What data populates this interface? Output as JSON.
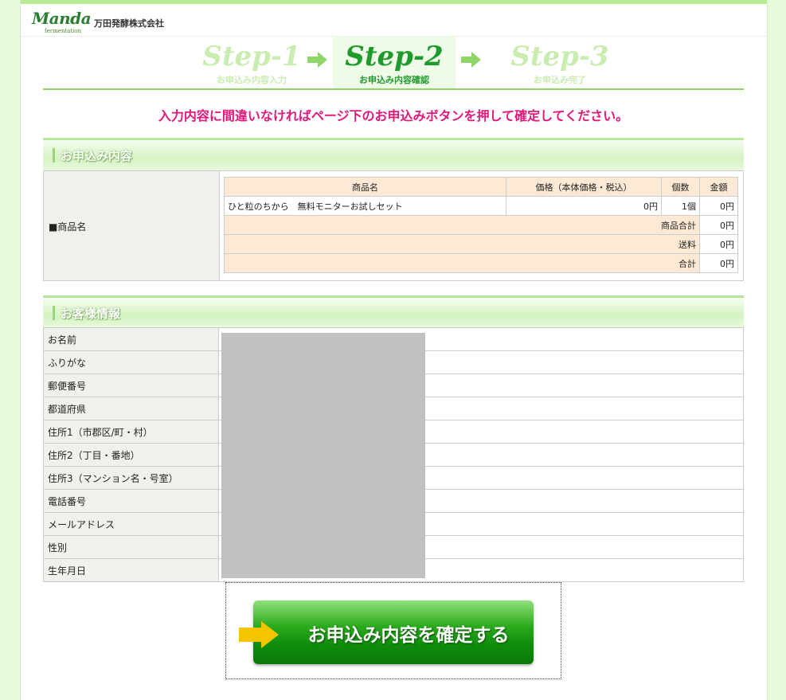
{
  "header": {
    "logo_main": "Manda",
    "logo_sub": "fermentation",
    "company": "万田発酵株式会社"
  },
  "steps": [
    {
      "title": "Step-1",
      "sub": "お申込み内容入力"
    },
    {
      "title": "Step-2",
      "sub": "お申込み内容確認"
    },
    {
      "title": "Step-3",
      "sub": "お申込み完了"
    }
  ],
  "notice": "入力内容に間違いなければページ下のお申込みボタンを押して確定してください。",
  "order": {
    "section_title": "お申込み内容",
    "label": "■商品名",
    "columns": [
      "商品名",
      "価格（本体価格・税込）",
      "個数",
      "金額"
    ],
    "item": {
      "name": "ひと粒のちから　無料モニターお試しセット",
      "price": "0円",
      "qty": "1個",
      "amount": "0円"
    },
    "subtotal_label": "商品合計",
    "subtotal": "0円",
    "shipping_label": "送料",
    "shipping": "0円",
    "total_label": "合計",
    "total": "0円"
  },
  "customer": {
    "section_title": "お客様情報",
    "fields": [
      "お名前",
      "ふりがな",
      "郵便番号",
      "都道府県",
      "住所1（市郡区/町・村）",
      "住所2（丁目・番地）",
      "住所3（マンション名・号室）",
      "電話番号",
      "メールアドレス",
      "性別",
      "生年月日"
    ]
  },
  "submit_label": "お申込み内容を確定する",
  "colors": {
    "accent": "#e0197a",
    "green": "#1f9a2d",
    "peach": "#fde9d4"
  }
}
